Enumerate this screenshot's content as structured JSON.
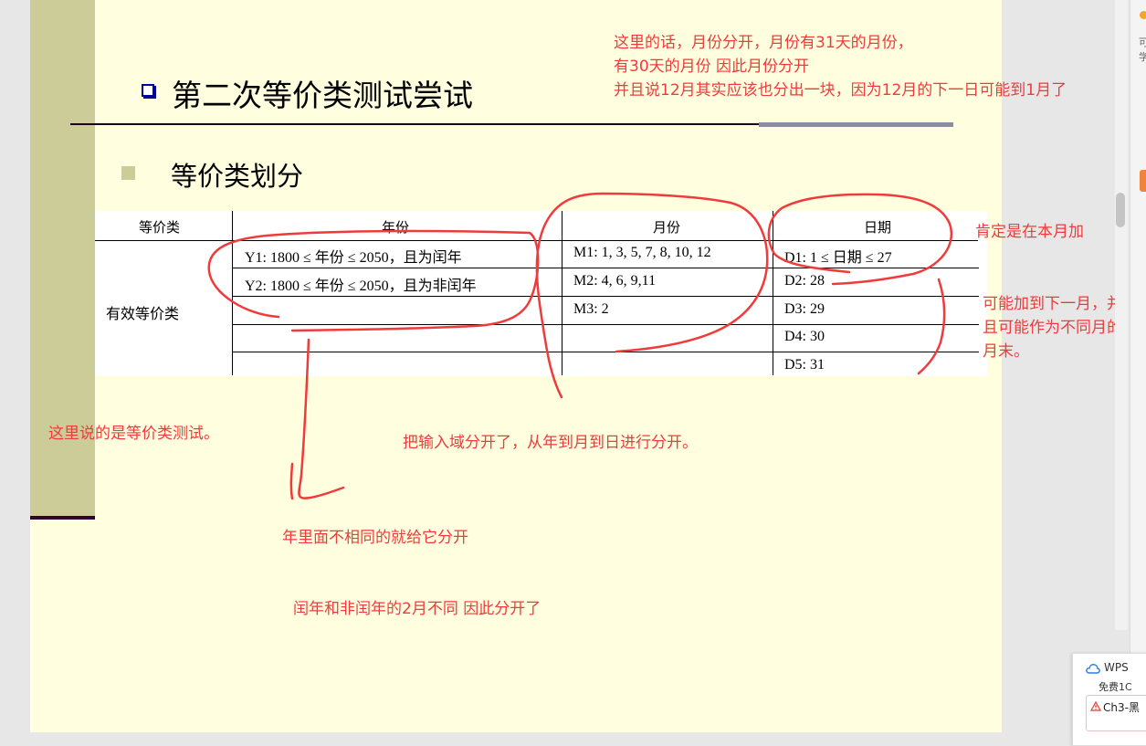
{
  "slide": {
    "title": "第二次等价类测试尝试",
    "subtitle": "等价类划分"
  },
  "table": {
    "headers": [
      "等价类",
      "年份",
      "月份",
      "日期"
    ],
    "row_label": "有效等价类",
    "year": [
      "Y1: 1800 ≤ 年份 ≤ 2050，且为闰年",
      "Y2: 1800 ≤ 年份 ≤ 2050，且为非闰年"
    ],
    "month": [
      "M1: 1, 3, 5, 7, 8, 10, 12",
      "M2: 4, 6, 9,11",
      "M3: 2"
    ],
    "day": [
      "D1: 1 ≤ 日期 ≤ 27",
      "D2: 28",
      "D3: 29",
      "D4: 30",
      "D5: 31"
    ]
  },
  "annotations": {
    "top_right": [
      "这里的话，月份分开，月份有31天的月份，",
      "有30天的月份 因此月份分开",
      "并且说12月其实应该也分出一块，因为12月的下一日可能到1月了"
    ],
    "month_add": "肯定是在本月加",
    "next_month": [
      "可能加到下一月，并",
      "且可能作为不同月的",
      "月末。"
    ],
    "equiv_test": "这里说的是等价类测试。",
    "split_domain": "把输入域分开了，从年到月到日进行分开。",
    "year_split": "年里面不相同的就给它分开",
    "leap_year": "闰年和非闰年的2月不同 因此分开了"
  },
  "side": {
    "wps_label": "WPS",
    "doc_name": "Ch3-黑",
    "doc_sub": "免费1C",
    "text1": "可",
    "text2": "学"
  },
  "colors": {
    "slide_bg": "#ffffe0",
    "left_bar": "#cccc99",
    "annotation_red": "#ef3b3b",
    "title_bullet": "#0000aa"
  }
}
